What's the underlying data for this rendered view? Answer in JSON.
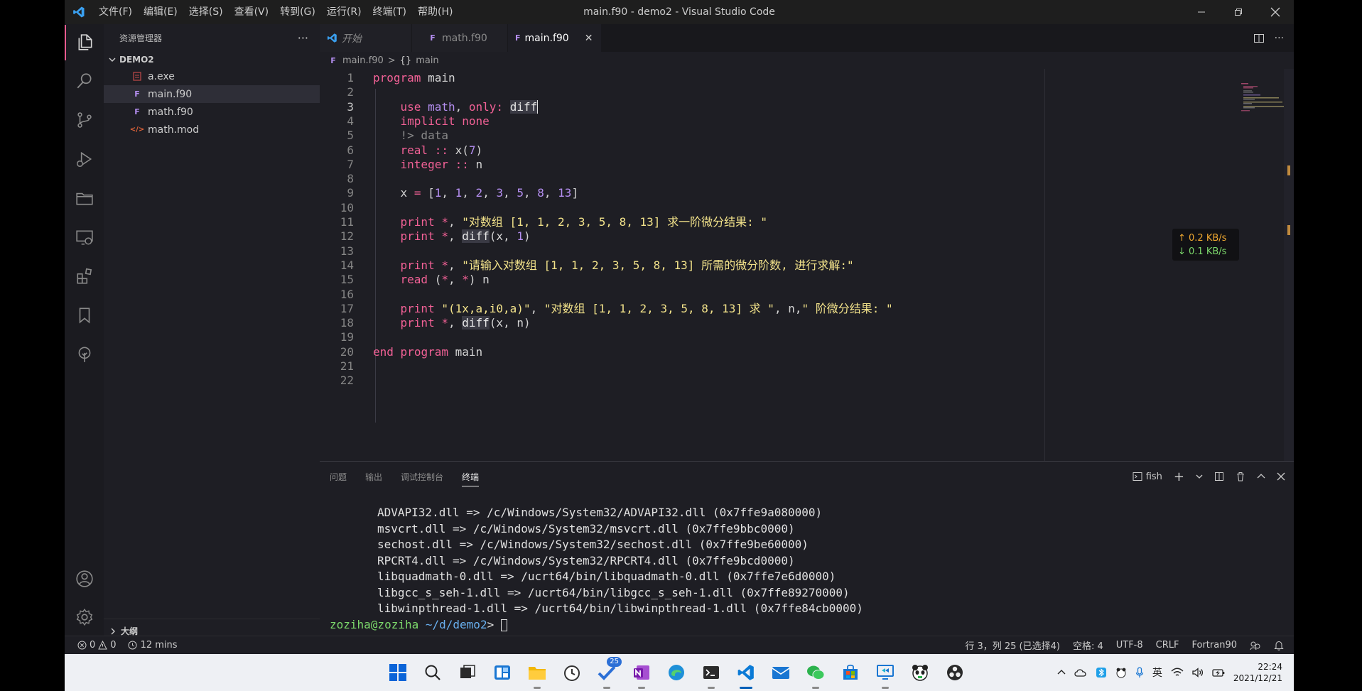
{
  "window": {
    "title": "main.f90 - demo2 - Visual Studio Code",
    "menus": [
      "文件(F)",
      "编辑(E)",
      "选择(S)",
      "查看(V)",
      "转到(G)",
      "运行(R)",
      "终端(T)",
      "帮助(H)"
    ]
  },
  "sidebar": {
    "title": "资源管理器",
    "folder": "DEMO2",
    "files": [
      {
        "name": "a.exe",
        "icon": "exe-file-icon"
      },
      {
        "name": "main.f90",
        "icon": "fortran-file-icon"
      },
      {
        "name": "math.f90",
        "icon": "fortran-file-icon"
      },
      {
        "name": "math.mod",
        "icon": "code-file-icon"
      }
    ],
    "outline": "大纲"
  },
  "tabs": [
    {
      "label": "开始",
      "icon": "vscode-icon"
    },
    {
      "label": "math.f90",
      "icon": "fortran-file-icon"
    },
    {
      "label": "main.f90",
      "icon": "fortran-file-icon"
    }
  ],
  "breadcrumb": {
    "file": "main.f90",
    "sep": ">",
    "symbol_icon": "{}",
    "symbol": "main"
  },
  "editor": {
    "current_line": 3,
    "line_numbers": [
      "1",
      "2",
      "3",
      "4",
      "5",
      "6",
      "7",
      "8",
      "9",
      "10",
      "11",
      "12",
      "13",
      "14",
      "15",
      "16",
      "17",
      "18",
      "19",
      "20",
      "21",
      "22"
    ],
    "tokens": {
      "program": "program",
      "main": "main",
      "use": "use",
      "math": "math",
      "only": "only",
      "colon": ":",
      "diff": "diff",
      "implicit": "implicit",
      "none": "none",
      "comment": "!> data",
      "real": "real",
      "dcolon": "::",
      "x": "x",
      "seven": "7",
      "integer": "integer",
      "n": "n",
      "eq": "=",
      "lbr": "[",
      "rbr": "]",
      "v1": "1",
      "v2": "2",
      "v3": "3",
      "v5": "5",
      "v8": "8",
      "v13": "13",
      "print": "print",
      "star": "*",
      "comma": ",",
      "lp": "(",
      "rp": ")",
      "s11": "\"对数组 [1, 1, 2, 3, 5, 8, 13] 求一阶微分结果: \"",
      "s14": "\"请输入对数组 [1, 1, 2, 3, 5, 8, 13] 所需的微分阶数, 进行求解:\"",
      "read": "read",
      "fmt17": "\"(1x,a,i0,a)\"",
      "s17a": "\"对数组 [1, 1, 2, 3, 5, 8, 13] 求 \"",
      "s17b": "\" 阶微分结果: \"",
      "end": "end"
    }
  },
  "network": {
    "up": "↑ 0.2 KB/s",
    "down": "↓ 0.1 KB/s",
    "up_color": "#f0a830",
    "down_color": "#7cd86b"
  },
  "panel": {
    "tabs": [
      "问题",
      "输出",
      "调试控制台",
      "终端"
    ],
    "active_tab": "终端",
    "shell": "fish",
    "terminal_lines": [
      "ADVAPI32.dll => /c/Windows/System32/ADVAPI32.dll (0x7ffe9a080000)",
      "msvcrt.dll => /c/Windows/System32/msvcrt.dll (0x7ffe9bbc0000)",
      "sechost.dll => /c/Windows/System32/sechost.dll (0x7ffe9be60000)",
      "RPCRT4.dll => /c/Windows/System32/RPCRT4.dll (0x7ffe9bcd0000)",
      "libquadmath-0.dll => /ucrt64/bin/libquadmath-0.dll (0x7ffe7e6d0000)",
      "libgcc_s_seh-1.dll => /ucrt64/bin/libgcc_s_seh-1.dll (0x7ffe89270000)",
      "libwinpthread-1.dll => /ucrt64/bin/libwinpthread-1.dll (0x7ffe84cb0000)"
    ],
    "prompt_user": "zoziha@zoziha",
    "prompt_path": "~/d/demo2",
    "prompt_symbol": ">"
  },
  "statusbar": {
    "errors": "0",
    "warnings": "0",
    "time": "12 mins",
    "position": "行 3，列 25 (已选择4)",
    "spaces": "空格: 4",
    "encoding": "UTF-8",
    "eol": "CRLF",
    "language": "Fortran90"
  },
  "taskbar": {
    "badge": "25",
    "ime": "英",
    "time": "22:24",
    "date": "2021/12/21"
  },
  "colors": {
    "accent": "#e85a8f",
    "fortran": "#b48ef0",
    "keyword": "#f26196",
    "string": "#f2e28a",
    "vscode_blue": "#3aa0f0"
  }
}
